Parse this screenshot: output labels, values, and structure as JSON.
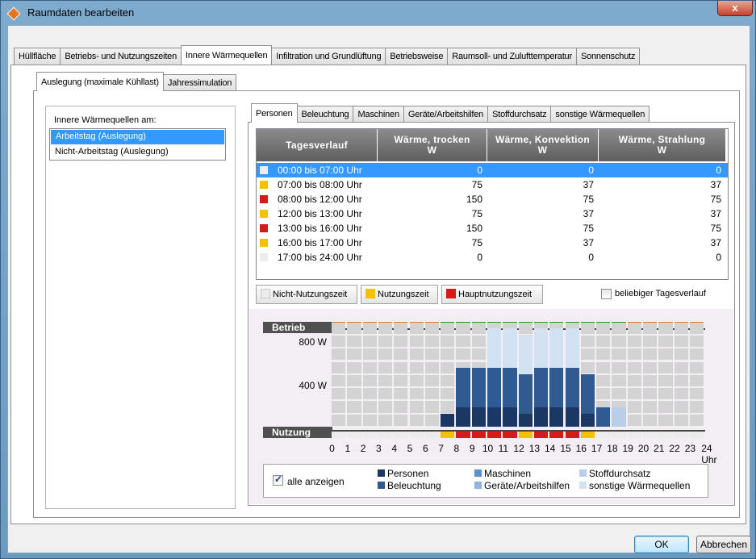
{
  "window": {
    "title": "Raumdaten bearbeiten",
    "close_label": "x"
  },
  "tabs_main": [
    {
      "label": "Hüllfläche",
      "w": 0
    },
    {
      "label": "Betriebs- und Nutzungszeiten"
    },
    {
      "label": "Innere Wärmequellen",
      "active": true
    },
    {
      "label": "Infiltration und Grundlüftung"
    },
    {
      "label": "Betriebsweise"
    },
    {
      "label": "Raumsoll- und Zulufttemperatur"
    },
    {
      "label": "Sonnenschutz"
    }
  ],
  "tabs_sub": [
    {
      "label": "Auslegung (maximale Kühllast)",
      "active": true
    },
    {
      "label": "Jahressimulation"
    }
  ],
  "left": {
    "label": "Innere Wärmequellen am:",
    "items": [
      "Arbeitstag (Auslegung)",
      "Nicht-Arbeitstag (Auslegung)"
    ],
    "selected": 0
  },
  "tabs_source": [
    {
      "label": "Personen",
      "active": true
    },
    {
      "label": "Beleuchtung"
    },
    {
      "label": "Maschinen"
    },
    {
      "label": "Geräte/Arbeitshilfen"
    },
    {
      "label": "Stoffdurchsatz"
    },
    {
      "label": "sonstige Wärmequellen"
    }
  ],
  "grid": {
    "headers": [
      {
        "line1": "Tagesverlauf",
        "line2": ""
      },
      {
        "line1": "Wärme, trocken",
        "line2": "W"
      },
      {
        "line1": "Wärme, Konvektion",
        "line2": "W"
      },
      {
        "line1": "Wärme, Strahlung",
        "line2": "W"
      }
    ],
    "rows": [
      {
        "period": "00:00 bis 07:00 Uhr",
        "dry": "0",
        "conv": "0",
        "rad": "0",
        "type": "nicht",
        "selected": true
      },
      {
        "period": "07:00 bis 08:00 Uhr",
        "dry": "75",
        "conv": "37",
        "rad": "37",
        "type": "nutzung"
      },
      {
        "period": "08:00 bis 12:00 Uhr",
        "dry": "150",
        "conv": "75",
        "rad": "75",
        "type": "haupt"
      },
      {
        "period": "12:00 bis 13:00 Uhr",
        "dry": "75",
        "conv": "37",
        "rad": "37",
        "type": "nutzung"
      },
      {
        "period": "13:00 bis 16:00 Uhr",
        "dry": "150",
        "conv": "75",
        "rad": "75",
        "type": "haupt"
      },
      {
        "period": "16:00 bis 17:00 Uhr",
        "dry": "75",
        "conv": "37",
        "rad": "37",
        "type": "nutzung"
      },
      {
        "period": "17:00 bis 24:00 Uhr",
        "dry": "0",
        "conv": "0",
        "rad": "0",
        "type": "nicht"
      }
    ]
  },
  "legend_buttons": {
    "nicht": "Nicht-Nutzungszeit",
    "nutzung": "Nutzungszeit",
    "haupt": "Hauptnutzungszeit",
    "free_day_label": "beliebiger Tagesverlauf"
  },
  "colors": {
    "nicht": "#ececec",
    "nutzung": "#f5c000",
    "haupt": "#d61a1a",
    "betrieb_on": "#1e9b1e",
    "betrieb_off": "#e87a1e",
    "personen": "#1b3764",
    "beleuchtung": "#2f5b92",
    "maschinen": "#5b8fd0",
    "geraete": "#8db3e2",
    "stoffdurchsatz": "#b8cfe8",
    "sonstige": "#d2e2f2",
    "empty": "#d3d3d3"
  },
  "chart_data": {
    "type": "bar",
    "title": "",
    "betrieb_label": "Betrieb",
    "nutzung_label": "Nutzung",
    "y_ticks": [
      "800 W",
      "400 W"
    ],
    "ylim": [
      0,
      900
    ],
    "x_ticks": [
      "0",
      "1",
      "2",
      "3",
      "4",
      "5",
      "6",
      "7",
      "8",
      "9",
      "10",
      "11",
      "12",
      "13",
      "14",
      "15",
      "16",
      "17",
      "18",
      "19",
      "20",
      "21",
      "22",
      "23",
      "24 Uhr"
    ],
    "betrieb": [
      "off",
      "off",
      "off",
      "off",
      "off",
      "off",
      "off",
      "on",
      "on",
      "on",
      "on",
      "on",
      "on",
      "on",
      "on",
      "on",
      "on",
      "on",
      "on",
      "off",
      "off",
      "off",
      "off",
      "off"
    ],
    "nutzung": [
      "nicht",
      "nicht",
      "nicht",
      "nicht",
      "nicht",
      "nicht",
      "nicht",
      "nutzung",
      "haupt",
      "haupt",
      "haupt",
      "haupt",
      "nutzung",
      "haupt",
      "haupt",
      "haupt",
      "nutzung",
      "nicht",
      "nicht",
      "nicht",
      "nicht",
      "nicht",
      "nicht",
      "nicht"
    ],
    "series": [
      {
        "name": "Personen",
        "values": [
          0,
          0,
          0,
          0,
          0,
          0,
          0,
          75,
          150,
          150,
          150,
          150,
          75,
          150,
          150,
          150,
          75,
          0,
          0,
          0,
          0,
          0,
          0,
          0
        ]
      },
      {
        "name": "Beleuchtung",
        "values": [
          0,
          0,
          0,
          0,
          0,
          0,
          0,
          0,
          300,
          300,
          300,
          300,
          300,
          300,
          300,
          300,
          300,
          150,
          0,
          0,
          0,
          0,
          0,
          0
        ]
      },
      {
        "name": "Stoffdurchsatz",
        "values": [
          0,
          0,
          0,
          0,
          0,
          0,
          0,
          0,
          0,
          0,
          0,
          0,
          0,
          0,
          0,
          0,
          0,
          0,
          150,
          0,
          0,
          0,
          0,
          0
        ]
      },
      {
        "name": "sonstige Wärmequellen",
        "values": [
          0,
          0,
          0,
          0,
          0,
          0,
          0,
          0,
          0,
          0,
          300,
          300,
          300,
          300,
          300,
          300,
          0,
          0,
          0,
          0,
          0,
          0,
          0,
          0
        ]
      }
    ],
    "legend": {
      "show_all_label": "alle anzeigen",
      "show_all_checked": true,
      "items": [
        {
          "label": "Personen",
          "color_key": "personen"
        },
        {
          "label": "Beleuchtung",
          "color_key": "beleuchtung"
        },
        {
          "label": "Maschinen",
          "color_key": "maschinen"
        },
        {
          "label": "Geräte/Arbeitshilfen",
          "color_key": "geraete"
        },
        {
          "label": "Stoffdurchsatz",
          "color_key": "stoffdurchsatz"
        },
        {
          "label": "sonstige Wärmequellen",
          "color_key": "sonstige"
        }
      ]
    }
  },
  "buttons": {
    "ok": "OK",
    "cancel": "Abbrechen"
  }
}
